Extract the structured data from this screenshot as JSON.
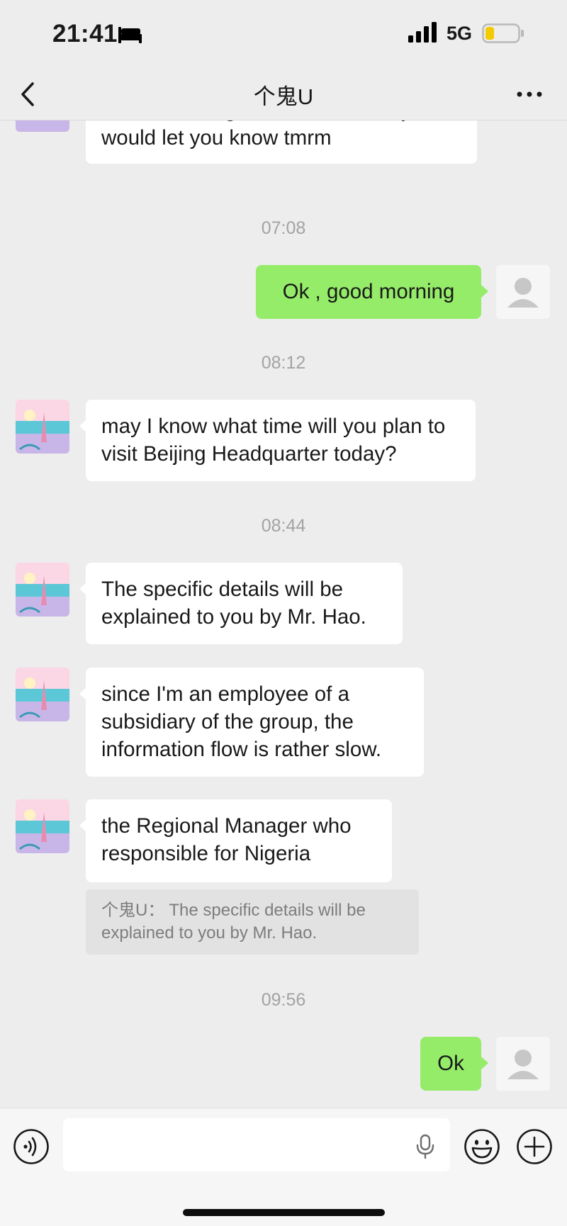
{
  "status_bar": {
    "time": "21:41",
    "network": "5G",
    "icons": [
      "bed-icon",
      "signal-icon",
      "battery-icon"
    ]
  },
  "nav": {
    "title": "个鬼U",
    "icons": [
      "back-icon",
      "more-icon"
    ]
  },
  "messages": {
    "partial_incoming": "is still deciding where to receive you, I would let you know tmrm",
    "time_1": "07:08",
    "outgoing_1": "Ok , good morning",
    "time_2": "08:12",
    "incoming_1": "may I know what time will you plan to visit Beijing Headquarter  today?",
    "time_3": "08:44",
    "incoming_2": "The specific details will be explained to you by Mr. Hao.",
    "incoming_3": "since I'm an employee of a subsidiary of the group, the information flow is rather slow.",
    "incoming_4": "the Regional Manager who responsible for Nigeria",
    "quote": {
      "author": "个鬼U：",
      "text": "The specific details will be explained to you by Mr. Hao."
    },
    "time_4": "09:56",
    "outgoing_2": "Ok"
  },
  "input_bar": {
    "value": "",
    "icons": [
      "voice-toggle-icon",
      "mic-icon",
      "emoji-icon",
      "plus-icon"
    ]
  },
  "colors": {
    "background": "#ededed",
    "outgoing_bubble": "#95ec69",
    "incoming_bubble": "#ffffff",
    "timestamp": "#a3a3a3",
    "quote_background": "#e2e2e2"
  }
}
